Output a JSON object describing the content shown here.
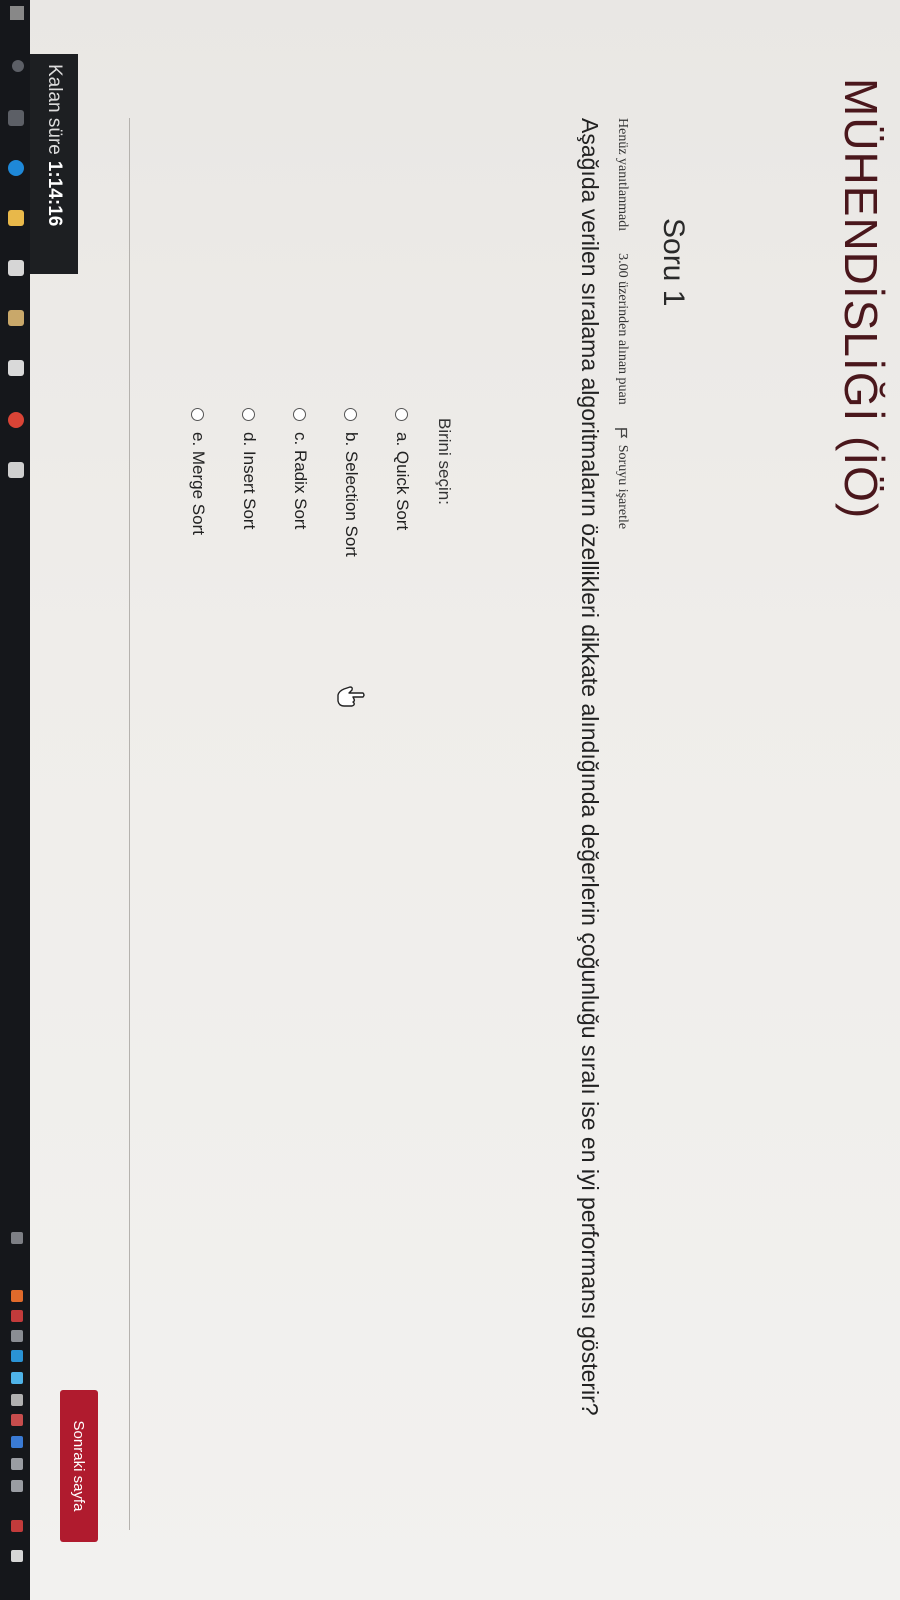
{
  "page": {
    "title": "MÜHENDİSLİĞİ (İÖ)"
  },
  "question": {
    "heading": "Soru 1",
    "status": "Henüz yanıtlanmadı",
    "score": "3.00 üzerinden alınan puan",
    "flag_label": "Soruyu işaretle",
    "text": "Aşağıda verilen sıralama algoritmaların özellikleri dikkate alındığında değerlerin çoğunluğu sıralı ise en iyi performansı gösterir?",
    "choose_label": "Birini seçin:",
    "answers": [
      {
        "label": "a. Quick Sort"
      },
      {
        "label": "b. Selection Sort"
      },
      {
        "label": "c. Radix Sort"
      },
      {
        "label": "d. Insert Sort"
      },
      {
        "label": "e. Merge Sort"
      }
    ]
  },
  "navigation": {
    "next_label": "Sonraki sayfa"
  },
  "timer": {
    "label": "Kalan süre",
    "value": "1:14:16"
  },
  "colors": {
    "title": "#4a171c",
    "next_button": "#b01b2e",
    "timer_bg": "#1d1f22"
  },
  "icons": {
    "flag": "flag-icon",
    "cursor": "hand-cursor-icon"
  }
}
